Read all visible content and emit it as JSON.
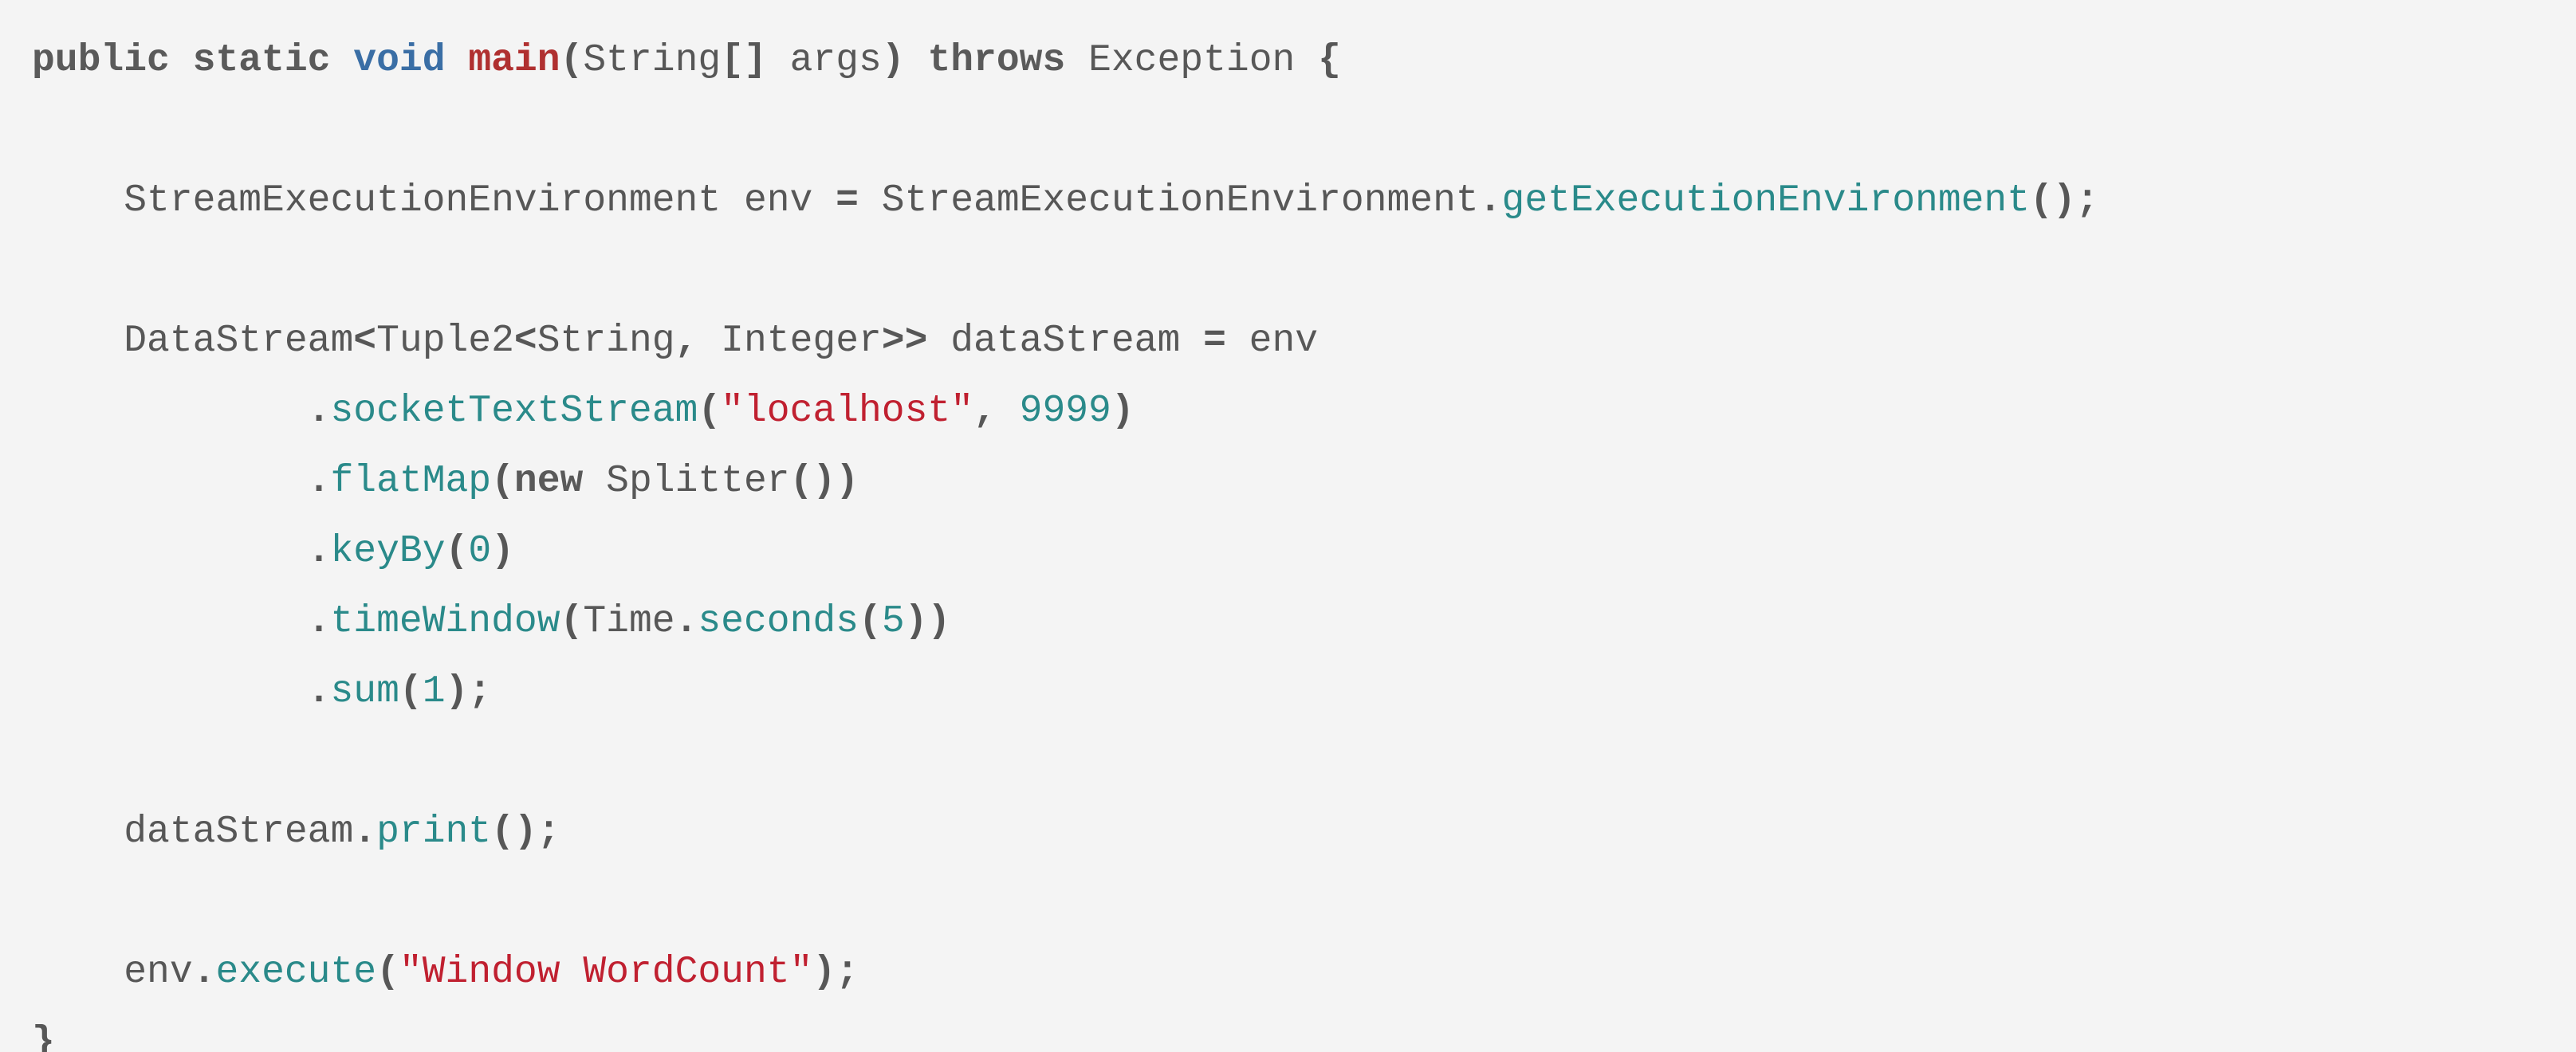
{
  "code": {
    "tokens": [
      {
        "cls": "kw",
        "txt": "public"
      },
      {
        "cls": "id",
        "txt": " "
      },
      {
        "cls": "kw",
        "txt": "static"
      },
      {
        "cls": "id",
        "txt": " "
      },
      {
        "cls": "kwtype",
        "txt": "void"
      },
      {
        "cls": "id",
        "txt": " "
      },
      {
        "cls": "fname",
        "txt": "main"
      },
      {
        "cls": "punc",
        "txt": "("
      },
      {
        "cls": "id",
        "txt": "String"
      },
      {
        "cls": "punc",
        "txt": "[] "
      },
      {
        "cls": "id",
        "txt": "args"
      },
      {
        "cls": "punc",
        "txt": ")"
      },
      {
        "cls": "id",
        "txt": " "
      },
      {
        "cls": "kw",
        "txt": "throws"
      },
      {
        "cls": "id",
        "txt": " Exception "
      },
      {
        "cls": "punc",
        "txt": "{"
      },
      {
        "cls": "id",
        "txt": "\n\n    StreamExecutionEnvironment env "
      },
      {
        "cls": "punc",
        "txt": "="
      },
      {
        "cls": "id",
        "txt": " StreamExecutionEnvironment"
      },
      {
        "cls": "punc",
        "txt": "."
      },
      {
        "cls": "method",
        "txt": "getExecutionEnvironment"
      },
      {
        "cls": "punc",
        "txt": "();"
      },
      {
        "cls": "id",
        "txt": "\n\n    DataStream"
      },
      {
        "cls": "punc",
        "txt": "<"
      },
      {
        "cls": "id",
        "txt": "Tuple2"
      },
      {
        "cls": "punc",
        "txt": "<"
      },
      {
        "cls": "id",
        "txt": "String"
      },
      {
        "cls": "punc",
        "txt": ","
      },
      {
        "cls": "id",
        "txt": " Integer"
      },
      {
        "cls": "punc",
        "txt": ">>"
      },
      {
        "cls": "id",
        "txt": " dataStream "
      },
      {
        "cls": "punc",
        "txt": "="
      },
      {
        "cls": "id",
        "txt": " env\n            "
      },
      {
        "cls": "punc",
        "txt": "."
      },
      {
        "cls": "method",
        "txt": "socketTextStream"
      },
      {
        "cls": "punc",
        "txt": "("
      },
      {
        "cls": "str",
        "txt": "\"localhost\""
      },
      {
        "cls": "punc",
        "txt": ","
      },
      {
        "cls": "id",
        "txt": " "
      },
      {
        "cls": "num",
        "txt": "9999"
      },
      {
        "cls": "punc",
        "txt": ")"
      },
      {
        "cls": "id",
        "txt": "\n            "
      },
      {
        "cls": "punc",
        "txt": "."
      },
      {
        "cls": "method",
        "txt": "flatMap"
      },
      {
        "cls": "punc",
        "txt": "("
      },
      {
        "cls": "kw",
        "txt": "new"
      },
      {
        "cls": "id",
        "txt": " Splitter"
      },
      {
        "cls": "punc",
        "txt": "())"
      },
      {
        "cls": "id",
        "txt": "\n            "
      },
      {
        "cls": "punc",
        "txt": "."
      },
      {
        "cls": "method",
        "txt": "keyBy"
      },
      {
        "cls": "punc",
        "txt": "("
      },
      {
        "cls": "num",
        "txt": "0"
      },
      {
        "cls": "punc",
        "txt": ")"
      },
      {
        "cls": "id",
        "txt": "\n            "
      },
      {
        "cls": "punc",
        "txt": "."
      },
      {
        "cls": "method",
        "txt": "timeWindow"
      },
      {
        "cls": "punc",
        "txt": "("
      },
      {
        "cls": "id",
        "txt": "Time"
      },
      {
        "cls": "punc",
        "txt": "."
      },
      {
        "cls": "method",
        "txt": "seconds"
      },
      {
        "cls": "punc",
        "txt": "("
      },
      {
        "cls": "num",
        "txt": "5"
      },
      {
        "cls": "punc",
        "txt": "))"
      },
      {
        "cls": "id",
        "txt": "\n            "
      },
      {
        "cls": "punc",
        "txt": "."
      },
      {
        "cls": "method",
        "txt": "sum"
      },
      {
        "cls": "punc",
        "txt": "("
      },
      {
        "cls": "num",
        "txt": "1"
      },
      {
        "cls": "punc",
        "txt": ");"
      },
      {
        "cls": "id",
        "txt": "\n\n    dataStream"
      },
      {
        "cls": "punc",
        "txt": "."
      },
      {
        "cls": "method",
        "txt": "print"
      },
      {
        "cls": "punc",
        "txt": "();"
      },
      {
        "cls": "id",
        "txt": "\n\n    env"
      },
      {
        "cls": "punc",
        "txt": "."
      },
      {
        "cls": "method",
        "txt": "execute"
      },
      {
        "cls": "punc",
        "txt": "("
      },
      {
        "cls": "str",
        "txt": "\"Window WordCount\""
      },
      {
        "cls": "punc",
        "txt": ");"
      },
      {
        "cls": "id",
        "txt": "\n"
      },
      {
        "cls": "punc",
        "txt": "}"
      }
    ]
  }
}
